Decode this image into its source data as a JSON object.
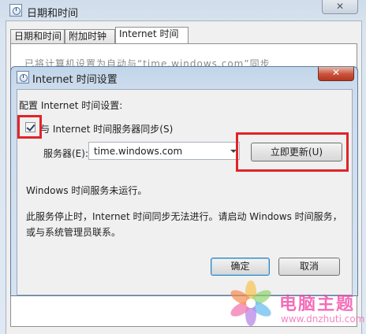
{
  "outer_window": {
    "title": "日期和时间",
    "close_glyph": "✕",
    "tabs": [
      {
        "label": "日期和时间"
      },
      {
        "label": "附加时钟"
      },
      {
        "label": "Internet 时间"
      }
    ],
    "obscured_text": "已将计算机设置为自动与“time.windows.com”同步"
  },
  "dialog": {
    "title": "Internet 时间设置",
    "close_glyph": "✕",
    "heading": "配置 Internet 时间设置:",
    "sync_checkbox": {
      "label": "与 Internet 时间服务器同步(S)",
      "checked": true
    },
    "server": {
      "label": "服务器(E):",
      "value": "time.windows.com"
    },
    "update_button": "立即更新(U)",
    "status_text": "Windows 时间服务未运行。",
    "message_lines": [
      "此服务停止时，Internet 时间同步无法进行。请启动 Windows 时间服务，",
      "或与系统管理员联系。"
    ],
    "ok_button": "确定",
    "cancel_button": "取消"
  },
  "highlight_color": "#e0242a",
  "watermark": {
    "title": "电脑主题",
    "url": "www.dnzhuti.com"
  }
}
